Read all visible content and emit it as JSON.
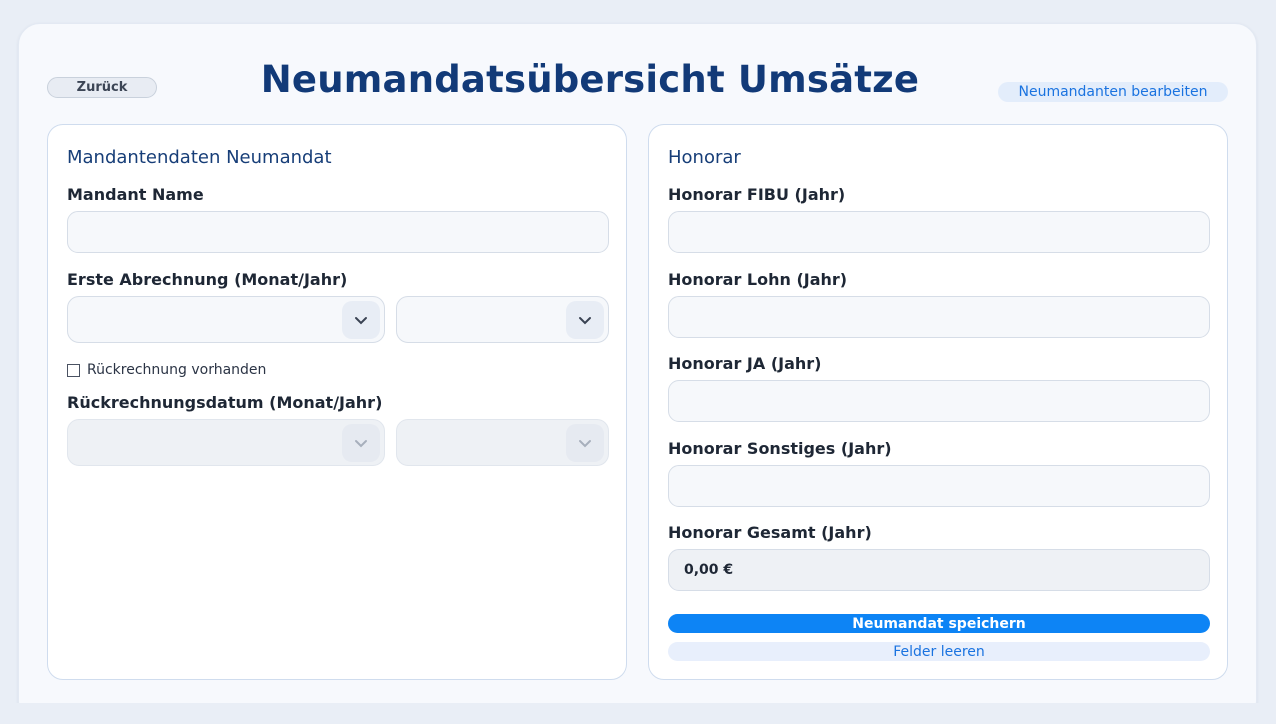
{
  "header": {
    "back_label": "Zurück",
    "title": "Neumandatsübersicht Umsätze",
    "edit_label": "Neumandanten bearbeiten"
  },
  "client_panel": {
    "title": "Mandantendaten Neumandat",
    "name_label": "Mandant Name",
    "name_value": "",
    "first_billing_label": "Erste Abrechnung (Monat/Jahr)",
    "first_billing_month": "",
    "first_billing_year": "",
    "retro_checkbox_label": "Rückrechnung vorhanden",
    "retro_checked": false,
    "retro_date_label": "Rückrechnungsdatum (Monat/Jahr)",
    "retro_month": "",
    "retro_year": ""
  },
  "fee_panel": {
    "title": "Honorar",
    "fields": [
      {
        "label": "Honorar FIBU (Jahr)",
        "value": ""
      },
      {
        "label": "Honorar Lohn (Jahr)",
        "value": ""
      },
      {
        "label": "Honorar JA (Jahr)",
        "value": ""
      },
      {
        "label": "Honorar Sonstiges (Jahr)",
        "value": ""
      }
    ],
    "total_label": "Honorar Gesamt (Jahr)",
    "total_value": "0,00 €",
    "save_label": "Neumandat speichern",
    "clear_label": "Felder leeren"
  },
  "colors": {
    "title": "#123a78",
    "primary": "#0d84f5",
    "link": "#1a73e0"
  }
}
